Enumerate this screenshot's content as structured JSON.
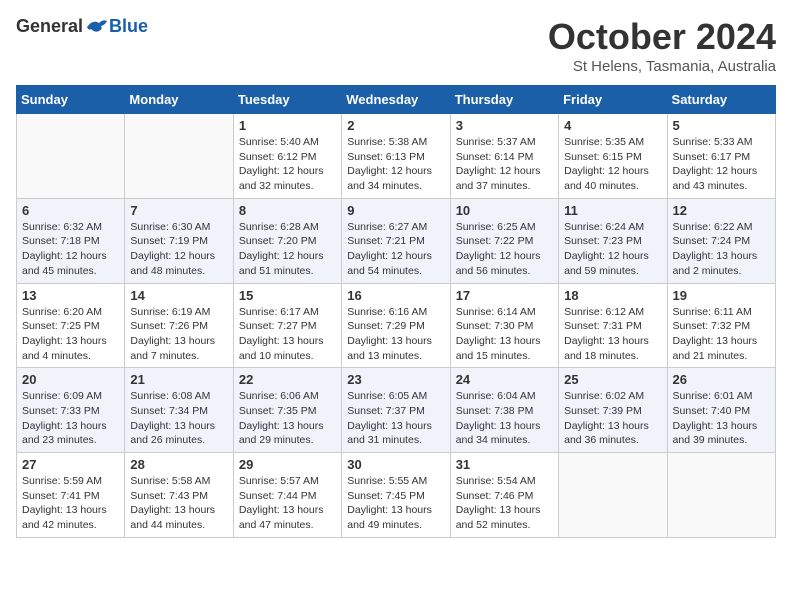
{
  "header": {
    "logo_general": "General",
    "logo_blue": "Blue",
    "month_title": "October 2024",
    "subtitle": "St Helens, Tasmania, Australia"
  },
  "days_of_week": [
    "Sunday",
    "Monday",
    "Tuesday",
    "Wednesday",
    "Thursday",
    "Friday",
    "Saturday"
  ],
  "weeks": [
    [
      {
        "day": "",
        "info": ""
      },
      {
        "day": "",
        "info": ""
      },
      {
        "day": "1",
        "info": "Sunrise: 5:40 AM\nSunset: 6:12 PM\nDaylight: 12 hours and 32 minutes."
      },
      {
        "day": "2",
        "info": "Sunrise: 5:38 AM\nSunset: 6:13 PM\nDaylight: 12 hours and 34 minutes."
      },
      {
        "day": "3",
        "info": "Sunrise: 5:37 AM\nSunset: 6:14 PM\nDaylight: 12 hours and 37 minutes."
      },
      {
        "day": "4",
        "info": "Sunrise: 5:35 AM\nSunset: 6:15 PM\nDaylight: 12 hours and 40 minutes."
      },
      {
        "day": "5",
        "info": "Sunrise: 5:33 AM\nSunset: 6:17 PM\nDaylight: 12 hours and 43 minutes."
      }
    ],
    [
      {
        "day": "6",
        "info": "Sunrise: 6:32 AM\nSunset: 7:18 PM\nDaylight: 12 hours and 45 minutes."
      },
      {
        "day": "7",
        "info": "Sunrise: 6:30 AM\nSunset: 7:19 PM\nDaylight: 12 hours and 48 minutes."
      },
      {
        "day": "8",
        "info": "Sunrise: 6:28 AM\nSunset: 7:20 PM\nDaylight: 12 hours and 51 minutes."
      },
      {
        "day": "9",
        "info": "Sunrise: 6:27 AM\nSunset: 7:21 PM\nDaylight: 12 hours and 54 minutes."
      },
      {
        "day": "10",
        "info": "Sunrise: 6:25 AM\nSunset: 7:22 PM\nDaylight: 12 hours and 56 minutes."
      },
      {
        "day": "11",
        "info": "Sunrise: 6:24 AM\nSunset: 7:23 PM\nDaylight: 12 hours and 59 minutes."
      },
      {
        "day": "12",
        "info": "Sunrise: 6:22 AM\nSunset: 7:24 PM\nDaylight: 13 hours and 2 minutes."
      }
    ],
    [
      {
        "day": "13",
        "info": "Sunrise: 6:20 AM\nSunset: 7:25 PM\nDaylight: 13 hours and 4 minutes."
      },
      {
        "day": "14",
        "info": "Sunrise: 6:19 AM\nSunset: 7:26 PM\nDaylight: 13 hours and 7 minutes."
      },
      {
        "day": "15",
        "info": "Sunrise: 6:17 AM\nSunset: 7:27 PM\nDaylight: 13 hours and 10 minutes."
      },
      {
        "day": "16",
        "info": "Sunrise: 6:16 AM\nSunset: 7:29 PM\nDaylight: 13 hours and 13 minutes."
      },
      {
        "day": "17",
        "info": "Sunrise: 6:14 AM\nSunset: 7:30 PM\nDaylight: 13 hours and 15 minutes."
      },
      {
        "day": "18",
        "info": "Sunrise: 6:12 AM\nSunset: 7:31 PM\nDaylight: 13 hours and 18 minutes."
      },
      {
        "day": "19",
        "info": "Sunrise: 6:11 AM\nSunset: 7:32 PM\nDaylight: 13 hours and 21 minutes."
      }
    ],
    [
      {
        "day": "20",
        "info": "Sunrise: 6:09 AM\nSunset: 7:33 PM\nDaylight: 13 hours and 23 minutes."
      },
      {
        "day": "21",
        "info": "Sunrise: 6:08 AM\nSunset: 7:34 PM\nDaylight: 13 hours and 26 minutes."
      },
      {
        "day": "22",
        "info": "Sunrise: 6:06 AM\nSunset: 7:35 PM\nDaylight: 13 hours and 29 minutes."
      },
      {
        "day": "23",
        "info": "Sunrise: 6:05 AM\nSunset: 7:37 PM\nDaylight: 13 hours and 31 minutes."
      },
      {
        "day": "24",
        "info": "Sunrise: 6:04 AM\nSunset: 7:38 PM\nDaylight: 13 hours and 34 minutes."
      },
      {
        "day": "25",
        "info": "Sunrise: 6:02 AM\nSunset: 7:39 PM\nDaylight: 13 hours and 36 minutes."
      },
      {
        "day": "26",
        "info": "Sunrise: 6:01 AM\nSunset: 7:40 PM\nDaylight: 13 hours and 39 minutes."
      }
    ],
    [
      {
        "day": "27",
        "info": "Sunrise: 5:59 AM\nSunset: 7:41 PM\nDaylight: 13 hours and 42 minutes."
      },
      {
        "day": "28",
        "info": "Sunrise: 5:58 AM\nSunset: 7:43 PM\nDaylight: 13 hours and 44 minutes."
      },
      {
        "day": "29",
        "info": "Sunrise: 5:57 AM\nSunset: 7:44 PM\nDaylight: 13 hours and 47 minutes."
      },
      {
        "day": "30",
        "info": "Sunrise: 5:55 AM\nSunset: 7:45 PM\nDaylight: 13 hours and 49 minutes."
      },
      {
        "day": "31",
        "info": "Sunrise: 5:54 AM\nSunset: 7:46 PM\nDaylight: 13 hours and 52 minutes."
      },
      {
        "day": "",
        "info": ""
      },
      {
        "day": "",
        "info": ""
      }
    ]
  ]
}
